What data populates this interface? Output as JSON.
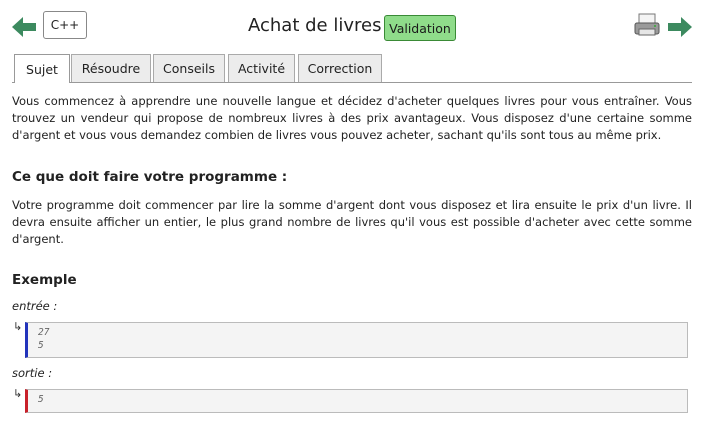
{
  "header": {
    "language_label": "C++",
    "title": "Achat de livres",
    "validation_label": "Validation",
    "accent_green": "#3c8a5f"
  },
  "tabs": [
    {
      "label": "Sujet",
      "active": true
    },
    {
      "label": "Résoudre",
      "active": false
    },
    {
      "label": "Conseils",
      "active": false
    },
    {
      "label": "Activité",
      "active": false
    },
    {
      "label": "Correction",
      "active": false
    }
  ],
  "content": {
    "intro": "Vous commencez à apprendre une nouvelle langue et décidez d'acheter quelques livres pour vous entraîner. Vous trouvez un vendeur qui propose de nombreux livres à des prix avantageux. Vous disposez d'une certaine somme d'argent et vous vous demandez combien de livres vous pouvez acheter, sachant qu'ils sont tous au même prix.",
    "task_heading": "Ce que doit faire votre programme :",
    "task_text": "Votre programme doit commencer par lire la somme d'argent dont vous disposez et lira ensuite le prix d'un livre. Il devra ensuite afficher un entier, le plus grand nombre de livres qu'il vous est possible d'acheter avec cette somme d'argent.",
    "example_heading": "Exemple",
    "input_label": "entrée :",
    "input_lines": [
      "27",
      "5"
    ],
    "output_label": "sortie :",
    "output_lines": [
      "5"
    ],
    "io_arrow": "↳"
  }
}
